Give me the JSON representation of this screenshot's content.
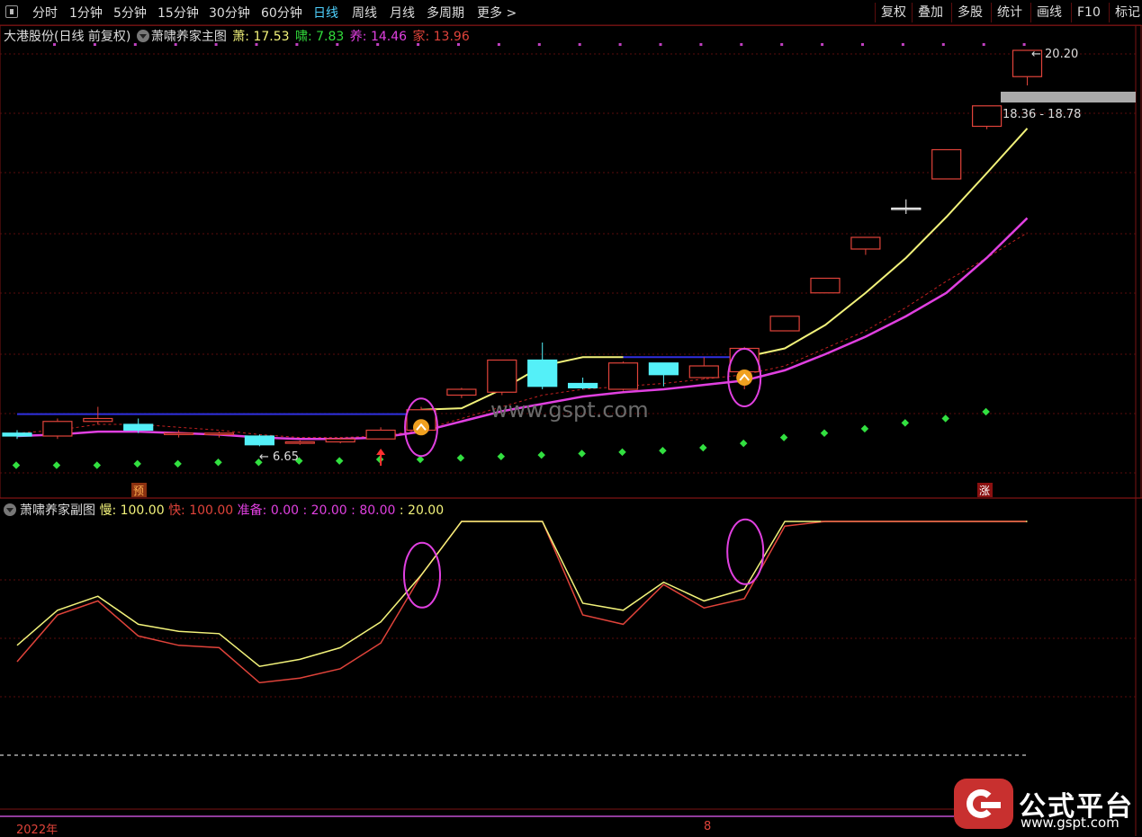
{
  "toolbar": {
    "periods": [
      "分时",
      "1分钟",
      "5分钟",
      "15分钟",
      "30分钟",
      "60分钟",
      "日线",
      "周线",
      "月线",
      "多周期",
      "更多 >"
    ],
    "active": "日线",
    "right": [
      "复权",
      "叠加",
      "多股",
      "统计",
      "画线",
      "F10",
      "标记"
    ]
  },
  "main_info": {
    "stock": "大港股份(日线 前复权)",
    "indicator": "萧啸养家主图",
    "items": [
      {
        "label": "萧: 17.53",
        "color": "#f2f27a"
      },
      {
        "label": "啸: 7.83",
        "color": "#32dc3c"
      },
      {
        "label": "养: 14.46",
        "color": "#e040e0"
      },
      {
        "label": "家: 13.96",
        "color": "#e0433a"
      }
    ]
  },
  "sub_info": {
    "indicator": "萧啸养家副图",
    "items": [
      {
        "label": "慢: 100.00",
        "color": "#f2f27a"
      },
      {
        "label": "快: 100.00",
        "color": "#e0433a"
      },
      {
        "label": "准备: 0.00",
        "color": "#e040e0"
      },
      {
        "label": ": 20.00",
        "color": "#e040e0"
      },
      {
        "label": ": 80.00",
        "color": "#e040e0"
      },
      {
        "label": ": 20.00",
        "color": "#f2f27a"
      }
    ]
  },
  "annotations": {
    "high_price": "20.20",
    "low_price": "6.65",
    "range_box": "18.36 - 18.78",
    "pre_tag": "预",
    "up_tag": "涨",
    "watermark": "www.gspt.com"
  },
  "axis": {
    "year_label": "2022年",
    "month_label": "8"
  },
  "brand": {
    "name": "公式平台",
    "url": "www.gspt.com"
  },
  "chart_data": {
    "type": "candlestick",
    "candles": [
      {
        "open": 7.1,
        "close": 7.0,
        "high": 7.2,
        "low": 6.9,
        "dir": "down"
      },
      {
        "open": 7.0,
        "close": 7.5,
        "high": 7.6,
        "low": 6.9,
        "dir": "up"
      },
      {
        "open": 7.5,
        "close": 7.6,
        "high": 8.0,
        "low": 7.4,
        "dir": "up"
      },
      {
        "open": 7.4,
        "close": 7.2,
        "high": 7.6,
        "low": 7.1,
        "dir": "down"
      },
      {
        "open": 7.1,
        "close": 7.05,
        "high": 7.2,
        "low": 6.95,
        "dir": "up"
      },
      {
        "open": 7.05,
        "close": 7.1,
        "high": 7.15,
        "low": 6.95,
        "dir": "up"
      },
      {
        "open": 7.0,
        "close": 6.7,
        "high": 7.05,
        "low": 6.65,
        "dir": "down"
      },
      {
        "open": 6.75,
        "close": 6.8,
        "high": 6.85,
        "low": 6.7,
        "dir": "up"
      },
      {
        "open": 6.8,
        "close": 6.9,
        "high": 6.95,
        "low": 6.75,
        "dir": "up"
      },
      {
        "open": 6.9,
        "close": 7.2,
        "high": 7.3,
        "low": 6.9,
        "dir": "up"
      },
      {
        "open": 7.2,
        "close": 7.9,
        "high": 8.0,
        "low": 7.1,
        "dir": "up"
      },
      {
        "open": 8.4,
        "close": 8.6,
        "high": 8.65,
        "low": 8.3,
        "dir": "up"
      },
      {
        "open": 8.5,
        "close": 9.6,
        "high": 9.6,
        "low": 8.4,
        "dir": "up"
      },
      {
        "open": 9.6,
        "close": 8.7,
        "high": 10.2,
        "low": 8.6,
        "dir": "down"
      },
      {
        "open": 8.8,
        "close": 8.65,
        "high": 9.0,
        "low": 8.6,
        "dir": "down"
      },
      {
        "open": 8.6,
        "close": 9.5,
        "high": 9.55,
        "low": 8.55,
        "dir": "up"
      },
      {
        "open": 9.5,
        "close": 9.1,
        "high": 9.5,
        "low": 8.7,
        "dir": "down"
      },
      {
        "open": 9.0,
        "close": 9.4,
        "high": 9.7,
        "low": 8.95,
        "dir": "up"
      },
      {
        "open": 9.2,
        "close": 10.0,
        "high": 10.05,
        "low": 8.6,
        "dir": "up"
      },
      {
        "open": 10.6,
        "close": 11.1,
        "high": 11.1,
        "low": 10.6,
        "dir": "up"
      },
      {
        "open": 11.9,
        "close": 12.4,
        "high": 12.4,
        "low": 11.9,
        "dir": "up"
      },
      {
        "open": 13.4,
        "close": 13.8,
        "high": 13.8,
        "low": 13.2,
        "dir": "up"
      },
      {
        "open": 14.8,
        "close": 14.8,
        "high": 15.1,
        "low": 14.6,
        "dir": "flat"
      },
      {
        "open": 15.8,
        "close": 16.8,
        "high": 16.8,
        "low": 15.8,
        "dir": "up"
      },
      {
        "open": 17.6,
        "close": 18.3,
        "high": 18.3,
        "low": 17.5,
        "dir": "up"
      },
      {
        "open": 19.3,
        "close": 20.2,
        "high": 20.2,
        "low": 19.0,
        "dir": "up"
      }
    ],
    "yellow_line": [
      null,
      null,
      null,
      null,
      null,
      null,
      null,
      null,
      null,
      null,
      7.9,
      7.95,
      8.6,
      9.4,
      9.7,
      9.7,
      null,
      null,
      9.7,
      10.0,
      10.8,
      11.9,
      13.1,
      14.5,
      16.0,
      17.53
    ],
    "magenta_line": [
      7.0,
      7.05,
      7.15,
      7.15,
      7.1,
      7.05,
      6.95,
      6.9,
      6.9,
      6.95,
      7.15,
      7.5,
      7.85,
      8.1,
      8.35,
      8.5,
      8.6,
      8.75,
      8.9,
      9.25,
      9.8,
      10.4,
      11.1,
      11.9,
      13.1,
      14.46
    ],
    "red_dash_line": [
      7.1,
      7.2,
      7.4,
      7.4,
      7.3,
      7.2,
      7.05,
      6.95,
      6.95,
      7.0,
      7.2,
      7.6,
      8.0,
      8.4,
      8.6,
      8.7,
      8.8,
      8.95,
      9.1,
      9.4,
      10.0,
      10.6,
      11.4,
      12.3,
      13.1,
      13.96
    ],
    "blue_line": [
      7.75,
      7.75,
      7.75,
      7.75,
      7.75,
      7.75,
      7.75,
      7.75,
      7.75,
      7.75,
      7.75,
      null,
      null,
      null,
      null,
      9.7,
      9.7,
      9.7,
      9.7,
      null,
      null,
      null,
      null,
      null,
      null,
      null
    ],
    "green_dots": [
      6.0,
      6.0,
      6.0,
      6.05,
      6.05,
      6.1,
      6.1,
      6.15,
      6.15,
      6.2,
      6.2,
      6.25,
      6.3,
      6.35,
      6.4,
      6.45,
      6.5,
      6.6,
      6.75,
      6.95,
      7.1,
      7.25,
      7.45,
      7.6,
      7.83,
      7.83
    ],
    "sub_slow": [
      47,
      62,
      68,
      56,
      53,
      52,
      38,
      41,
      46,
      57,
      77,
      100,
      100,
      100,
      65,
      62,
      74,
      66,
      71,
      100,
      100,
      100,
      100,
      100,
      100,
      100
    ],
    "sub_fast": [
      40,
      60,
      66,
      51,
      47,
      46,
      31,
      33,
      37,
      48,
      77,
      100,
      100,
      100,
      60,
      56,
      73,
      63,
      67,
      98,
      100,
      100,
      100,
      100,
      100,
      100
    ],
    "sub_levels": [
      0,
      20,
      80
    ]
  }
}
